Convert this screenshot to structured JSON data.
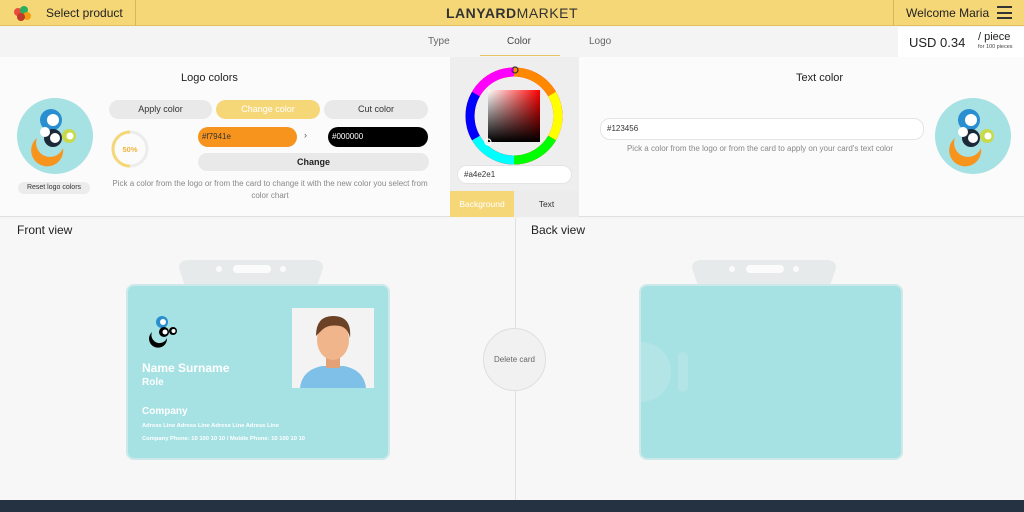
{
  "topbar": {
    "product_label": "Select product",
    "brand_bold": "LANYARD",
    "brand_light": "MARKET",
    "welcome": "Welcome Maria"
  },
  "tabs": [
    {
      "label": "Type",
      "active": false
    },
    {
      "label": "Color",
      "active": true
    },
    {
      "label": "Logo",
      "active": false
    }
  ],
  "price": {
    "amount": "USD 0.34",
    "unit": "/ piece",
    "note": "for 100 pieces"
  },
  "logo_colors": {
    "title": "Logo colors",
    "apply_label": "Apply color",
    "change_label": "Change color",
    "cut_label": "Cut color",
    "reset_label": "Reset logo colors",
    "progress": "50%",
    "progress_fraction": 0.5,
    "from_color": "#f7941e",
    "to_color": "#000000",
    "change_button": "Change",
    "hint": "Pick a color from the logo or from the card to change it with the new color you select from color chart"
  },
  "color_picker": {
    "hex_value": "#a4e2e1",
    "background_tab": "Background",
    "text_tab": "Text"
  },
  "text_color": {
    "title": "Text color",
    "value": "#123456",
    "hint": "Pick a color from the logo or from the card to apply on your card's text color"
  },
  "front_view": {
    "title": "Front view",
    "name": "Name Surname",
    "role": "Role",
    "company": "Company",
    "address": "Adress Line Adress Line Adress Line Adress Line",
    "phones": "Company Phone: 10 100 10 10 / Mobile Phone: 10 100 10 10"
  },
  "back_view": {
    "title": "Back view"
  },
  "delete_card": "Delete card",
  "colors": {
    "accent": "#f6d778",
    "card": "#a6e1e3",
    "orange": "#f7941e",
    "footer": "#243241"
  }
}
